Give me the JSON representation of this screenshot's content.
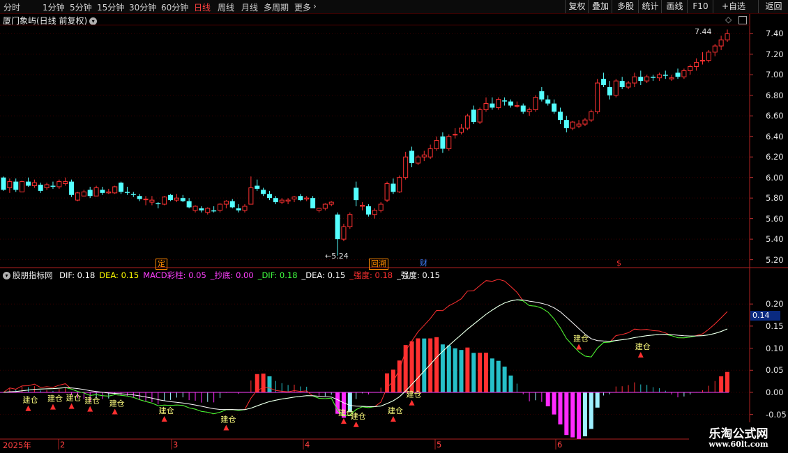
{
  "toolbar": {
    "periods": [
      "分时",
      "1分钟",
      "5分钟",
      "15分钟",
      "30分钟",
      "60分钟",
      "日线",
      "周线",
      "月线",
      "多周期",
      "更多"
    ],
    "active_index": 6,
    "more_arrow": "chevron-right-icon",
    "right_buttons": [
      "复权",
      "叠加",
      "多股",
      "统计",
      "画线",
      "F10",
      "+自选",
      "返回"
    ]
  },
  "header": {
    "title": "厦门象屿(日线 前复权)",
    "dropdown_icon": "chevron-down-icon",
    "corner_icons": [
      "diamond-icon",
      "window-toggle-icon"
    ]
  },
  "price_axis": {
    "ticks": [
      "7.40",
      "7.20",
      "7.00",
      "6.80",
      "6.60",
      "6.40",
      "6.20",
      "6.00",
      "5.80",
      "5.60",
      "5.40",
      "5.20"
    ],
    "max_label": "7.44",
    "min_label": "5.24"
  },
  "event_tags": [
    {
      "text": "定",
      "color": "#ff8c00"
    },
    {
      "text": "回溯",
      "color": "#ff8c00"
    },
    {
      "text": "财",
      "color": "#4080ff"
    },
    {
      "text": "$",
      "color": "#ff3030"
    }
  ],
  "indicator": {
    "name": "股朋指标网",
    "items": [
      {
        "text": "DIF: 0.18",
        "color": "#ffffff"
      },
      {
        "text": "DEA: 0.15",
        "color": "#ffff00"
      },
      {
        "text": "MACD彩柱: 0.05",
        "color": "#ff40ff"
      },
      {
        "text": "_抄底: 0.00",
        "color": "#ff40ff"
      },
      {
        "text": "_DIF: 0.18",
        "color": "#40ff40"
      },
      {
        "text": "_DEA: 0.15",
        "color": "#ffffff"
      },
      {
        "text": "_强度: 0.18",
        "color": "#ff3030"
      },
      {
        "text": "_强度: 0.15",
        "color": "#ffffff"
      }
    ],
    "axis_ticks": [
      "0.20",
      "0.15",
      "0.10",
      "0.05",
      "0.00",
      "-0.05"
    ],
    "current_value": "0.14",
    "signal_label": "建仓"
  },
  "date_axis": {
    "labels": [
      "2025年",
      "2",
      "3",
      "4",
      "5",
      "6"
    ]
  },
  "colors": {
    "up": "#ff3232",
    "down": "#54ffff",
    "background": "#000000",
    "grid": "#3a0000"
  },
  "watermark": {
    "line1": "乐淘公式网",
    "line2": "www.60lt.com"
  },
  "chart_data": {
    "type": "candlestick",
    "candles": [
      [
        6.0,
        6.01,
        5.87,
        5.88
      ],
      [
        5.9,
        5.99,
        5.85,
        5.96
      ],
      [
        5.96,
        5.99,
        5.86,
        5.88
      ],
      [
        5.86,
        5.97,
        5.86,
        5.96
      ],
      [
        5.96,
        6.0,
        5.91,
        5.92
      ],
      [
        5.92,
        5.98,
        5.9,
        5.95
      ],
      [
        5.93,
        5.95,
        5.85,
        5.87
      ],
      [
        5.9,
        5.95,
        5.88,
        5.93
      ],
      [
        5.92,
        5.96,
        5.89,
        5.91
      ],
      [
        5.91,
        5.98,
        5.89,
        5.96
      ],
      [
        5.94,
        6.0,
        5.92,
        5.96
      ],
      [
        5.96,
        5.98,
        5.81,
        5.83
      ],
      [
        5.78,
        5.86,
        5.77,
        5.85
      ],
      [
        5.82,
        5.88,
        5.82,
        5.86
      ],
      [
        5.88,
        5.91,
        5.8,
        5.82
      ],
      [
        5.82,
        5.92,
        5.82,
        5.9
      ],
      [
        5.88,
        5.91,
        5.83,
        5.85
      ],
      [
        5.85,
        5.89,
        5.84,
        5.86
      ],
      [
        5.85,
        5.92,
        5.84,
        5.91
      ],
      [
        5.95,
        5.96,
        5.84,
        5.86
      ],
      [
        5.86,
        5.91,
        5.83,
        5.85
      ],
      [
        5.84,
        5.86,
        5.81,
        5.83
      ],
      [
        5.82,
        5.84,
        5.77,
        5.79
      ],
      [
        5.79,
        5.82,
        5.73,
        5.79
      ],
      [
        5.76,
        5.82,
        5.73,
        5.78
      ],
      [
        5.75,
        5.76,
        5.7,
        5.74
      ],
      [
        5.74,
        5.82,
        5.73,
        5.81
      ],
      [
        5.83,
        5.84,
        5.77,
        5.78
      ],
      [
        5.78,
        5.84,
        5.76,
        5.8
      ],
      [
        5.8,
        5.83,
        5.76,
        5.77
      ],
      [
        5.77,
        5.8,
        5.7,
        5.71
      ],
      [
        5.68,
        5.73,
        5.66,
        5.72
      ],
      [
        5.7,
        5.72,
        5.66,
        5.68
      ],
      [
        5.66,
        5.71,
        5.64,
        5.7
      ],
      [
        5.68,
        5.72,
        5.66,
        5.67
      ],
      [
        5.68,
        5.75,
        5.66,
        5.74
      ],
      [
        5.74,
        5.78,
        5.7,
        5.77
      ],
      [
        5.77,
        5.79,
        5.7,
        5.71
      ],
      [
        5.7,
        5.74,
        5.66,
        5.68
      ],
      [
        5.68,
        5.74,
        5.66,
        5.72
      ],
      [
        5.74,
        6.01,
        5.74,
        5.9
      ],
      [
        5.92,
        5.98,
        5.87,
        5.89
      ],
      [
        5.88,
        5.9,
        5.82,
        5.84
      ],
      [
        5.84,
        5.87,
        5.78,
        5.8
      ],
      [
        5.8,
        5.82,
        5.74,
        5.76
      ],
      [
        5.76,
        5.8,
        5.74,
        5.78
      ],
      [
        5.77,
        5.8,
        5.74,
        5.78
      ],
      [
        5.79,
        5.82,
        5.76,
        5.81
      ],
      [
        5.82,
        5.84,
        5.77,
        5.78
      ],
      [
        5.79,
        5.82,
        5.77,
        5.8
      ],
      [
        5.8,
        5.82,
        5.72,
        5.7
      ],
      [
        5.68,
        5.7,
        5.66,
        5.7
      ],
      [
        5.7,
        5.75,
        5.68,
        5.74
      ],
      [
        5.74,
        5.77,
        5.72,
        5.76
      ],
      [
        5.64,
        5.66,
        5.24,
        5.4
      ],
      [
        5.4,
        5.55,
        5.38,
        5.52
      ],
      [
        5.52,
        5.66,
        5.5,
        5.64
      ],
      [
        5.9,
        5.96,
        5.72,
        5.78
      ],
      [
        5.72,
        5.76,
        5.68,
        5.73
      ],
      [
        5.72,
        5.74,
        5.62,
        5.64
      ],
      [
        5.64,
        5.7,
        5.6,
        5.68
      ],
      [
        5.68,
        5.76,
        5.66,
        5.74
      ],
      [
        5.78,
        5.96,
        5.76,
        5.94
      ],
      [
        5.94,
        5.99,
        5.84,
        5.86
      ],
      [
        5.86,
        6.02,
        5.85,
        6.0
      ],
      [
        6.0,
        6.25,
        5.98,
        6.2
      ],
      [
        6.26,
        6.3,
        6.1,
        6.14
      ],
      [
        6.14,
        6.22,
        6.12,
        6.2
      ],
      [
        6.2,
        6.26,
        6.16,
        6.22
      ],
      [
        6.2,
        6.32,
        6.18,
        6.28
      ],
      [
        6.28,
        6.4,
        6.26,
        6.36
      ],
      [
        6.4,
        6.44,
        6.24,
        6.28
      ],
      [
        6.28,
        6.42,
        6.26,
        6.4
      ],
      [
        6.42,
        6.48,
        6.38,
        6.42
      ],
      [
        6.44,
        6.52,
        6.42,
        6.48
      ],
      [
        6.48,
        6.62,
        6.46,
        6.6
      ],
      [
        6.66,
        6.7,
        6.52,
        6.54
      ],
      [
        6.54,
        6.68,
        6.52,
        6.66
      ],
      [
        6.66,
        6.78,
        6.64,
        6.72
      ],
      [
        6.72,
        6.78,
        6.66,
        6.68
      ],
      [
        6.68,
        6.78,
        6.66,
        6.76
      ],
      [
        6.75,
        6.78,
        6.7,
        6.74
      ],
      [
        6.74,
        6.76,
        6.68,
        6.7
      ],
      [
        6.7,
        6.74,
        6.68,
        6.7
      ],
      [
        6.7,
        6.72,
        6.62,
        6.64
      ],
      [
        6.64,
        6.68,
        6.6,
        6.66
      ],
      [
        6.66,
        6.8,
        6.64,
        6.78
      ],
      [
        6.84,
        6.88,
        6.74,
        6.76
      ],
      [
        6.76,
        6.8,
        6.7,
        6.72
      ],
      [
        6.72,
        6.76,
        6.62,
        6.64
      ],
      [
        6.64,
        6.68,
        6.52,
        6.56
      ],
      [
        6.56,
        6.6,
        6.44,
        6.48
      ],
      [
        6.48,
        6.55,
        6.46,
        6.54
      ],
      [
        6.5,
        6.56,
        6.48,
        6.52
      ],
      [
        6.52,
        6.58,
        6.5,
        6.56
      ],
      [
        6.56,
        6.66,
        6.54,
        6.64
      ],
      [
        6.64,
        6.96,
        6.62,
        6.92
      ],
      [
        6.96,
        7.02,
        6.88,
        6.9
      ],
      [
        6.88,
        6.94,
        6.76,
        6.8
      ],
      [
        6.8,
        6.96,
        6.78,
        6.94
      ],
      [
        6.94,
        6.98,
        6.86,
        6.88
      ],
      [
        6.88,
        6.94,
        6.86,
        6.92
      ],
      [
        6.92,
        7.02,
        6.88,
        6.98
      ],
      [
        6.98,
        7.04,
        6.9,
        6.94
      ],
      [
        6.94,
        7.0,
        6.92,
        6.98
      ],
      [
        6.98,
        7.0,
        6.94,
        6.97
      ],
      [
        6.97,
        7.02,
        6.94,
        7.0
      ],
      [
        7.0,
        7.04,
        6.96,
        6.99
      ],
      [
        6.96,
        7.0,
        6.94,
        6.97
      ],
      [
        7.02,
        7.06,
        6.96,
        6.98
      ],
      [
        6.98,
        7.06,
        6.96,
        7.04
      ],
      [
        7.04,
        7.1,
        7.0,
        7.08
      ],
      [
        7.08,
        7.16,
        7.04,
        7.12
      ],
      [
        7.14,
        7.22,
        7.1,
        7.14
      ],
      [
        7.14,
        7.24,
        7.12,
        7.22
      ],
      [
        7.22,
        7.3,
        7.18,
        7.28
      ],
      [
        7.28,
        7.38,
        7.24,
        7.34
      ],
      [
        7.34,
        7.44,
        7.32,
        7.4
      ]
    ],
    "indicator_axis": [
      -0.05,
      0.2
    ],
    "price_axis": [
      5.2,
      7.4
    ]
  }
}
